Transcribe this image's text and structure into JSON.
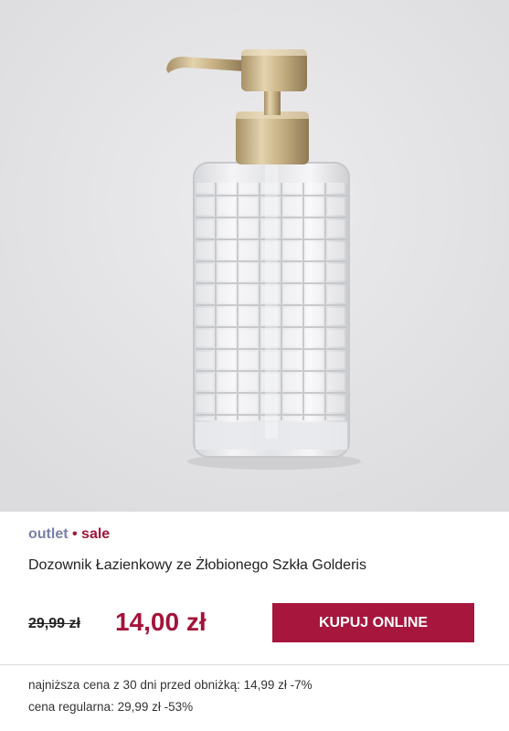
{
  "product": {
    "image_alt": "soap-dispenser-photo",
    "tag_outlet": "outlet",
    "tag_separator": " • ",
    "tag_sale": "sale",
    "name": "Dozownik Łazienkowy ze Żłobionego Szkła Golderis",
    "old_price": "29,99 zł",
    "price": "14,00 zł",
    "buy_label": "KUPUJ ONLINE",
    "lowest_price_note": "najniższa cena z 30 dni przed obniżką: 14,99 zł -7%",
    "regular_price_note": "cena regularna: 29,99 zł -53%"
  },
  "colors": {
    "accent": "#a3143a",
    "outlet_tag": "#7b7fa8",
    "image_bg": "#e6e6e8",
    "pump_gold": "#c9b386"
  }
}
